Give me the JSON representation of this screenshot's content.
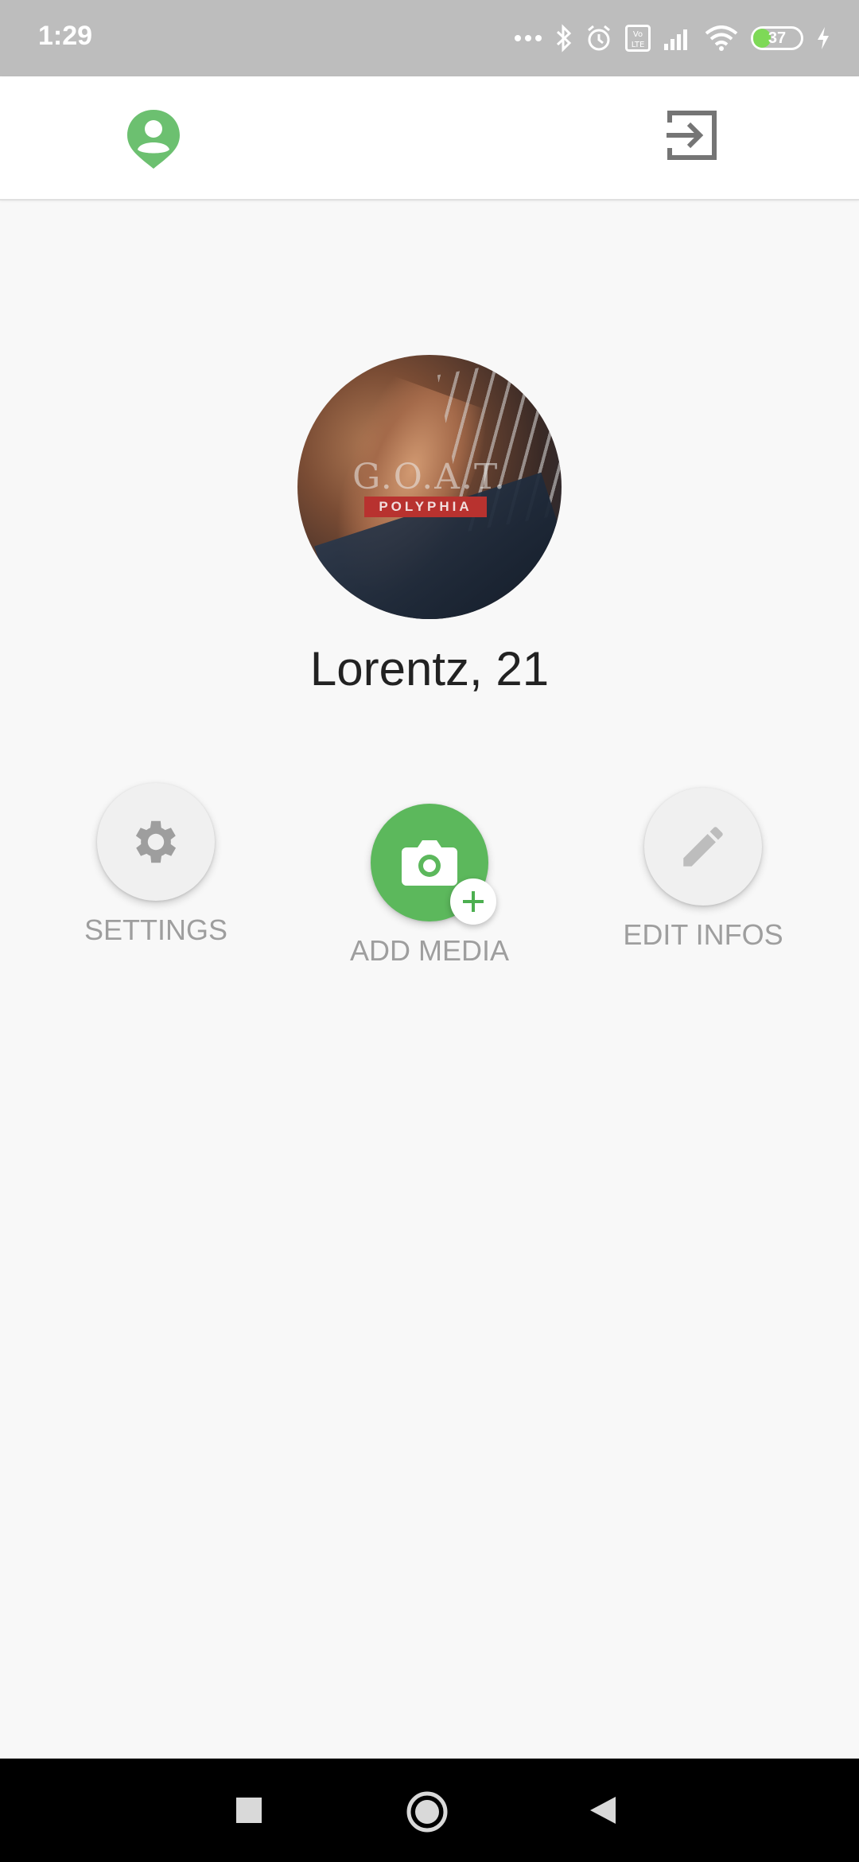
{
  "status_bar": {
    "time": "1:29",
    "battery_percent": "37",
    "battery_level": 0.37,
    "icons": [
      "more-dots-icon",
      "bluetooth-icon",
      "alarm-icon",
      "volte-icon",
      "signal-icon",
      "wifi-icon",
      "battery-icon",
      "charging-icon"
    ]
  },
  "app_bar": {
    "profile_icon": "profile-pin-icon",
    "logout_icon": "exit-icon",
    "accent_color": "#6cc070"
  },
  "profile": {
    "name": "Lorentz, 21",
    "avatar_logo_text": "G.O.A.T.",
    "avatar_band_text": "POLYPHIA"
  },
  "actions": {
    "settings_label": "SETTINGS",
    "add_media_label": "ADD MEDIA",
    "edit_infos_label": "EDIT INFOS",
    "primary_color": "#5cb85c"
  },
  "nav_bar": {
    "icons": [
      "recents-square-icon",
      "home-circle-icon",
      "back-triangle-icon"
    ]
  }
}
